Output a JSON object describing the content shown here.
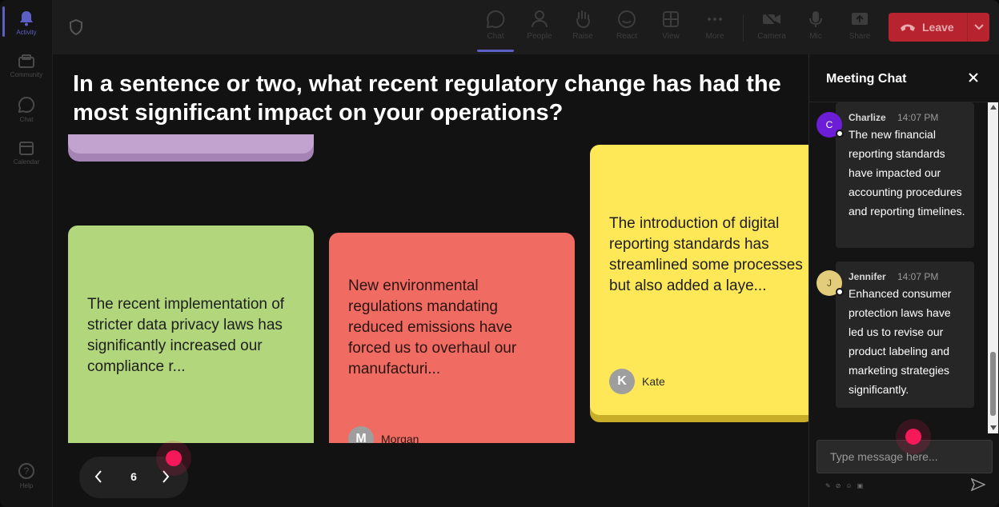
{
  "rail": {
    "items": [
      {
        "label": "Activity"
      },
      {
        "label": "Community"
      },
      {
        "label": "Chat"
      },
      {
        "label": "Calendar"
      },
      {
        "label": "Help"
      }
    ]
  },
  "toolbar": {
    "chat_label": "Chat",
    "people_label": "People",
    "raise_label": "Raise",
    "react_label": "React",
    "view_label": "View",
    "more_label": "More",
    "camera_label": "Camera",
    "mic_label": "Mic",
    "share_label": "Share",
    "leave_label": "Leave"
  },
  "question": "In a sentence or two, what recent regulatory change has had the most significant impact on your operations?",
  "cards": [
    {
      "text": "The recent implementation of stricter data privacy laws has significantly increased our compliance r...",
      "author": "",
      "color": "#b1d67b"
    },
    {
      "text": "New environmental regulations mandating reduced emissions have forced us to overhaul our manufacturi...",
      "author": "Morgan",
      "initial": "M",
      "color": "#f06b61"
    },
    {
      "text": "The introduction of digital reporting standards has streamlined some processes but also added a laye...",
      "author": "Kate",
      "initial": "K",
      "color": "#fee858"
    }
  ],
  "pager": {
    "page": "6"
  },
  "chat": {
    "title": "Meeting Chat",
    "messages": [
      {
        "author": "Charlize",
        "initial": "C",
        "time": "14:07 PM",
        "text": "The new financial reporting standards have impacted our accounting procedures and reporting timelines.",
        "avatar_color": "#6b1ed6"
      },
      {
        "author": "Jennifer",
        "initial": "J",
        "time": "14:07 PM",
        "text": "Enhanced consumer protection laws have led us to revise our product labeling and marketing strategies significantly.",
        "avatar_color": "#e3cc7a"
      }
    ],
    "input_placeholder": "Type message here..."
  },
  "colors": {
    "accent": "#5c5fc4",
    "leave": "#b7242f",
    "cursor": "#f5195a"
  }
}
